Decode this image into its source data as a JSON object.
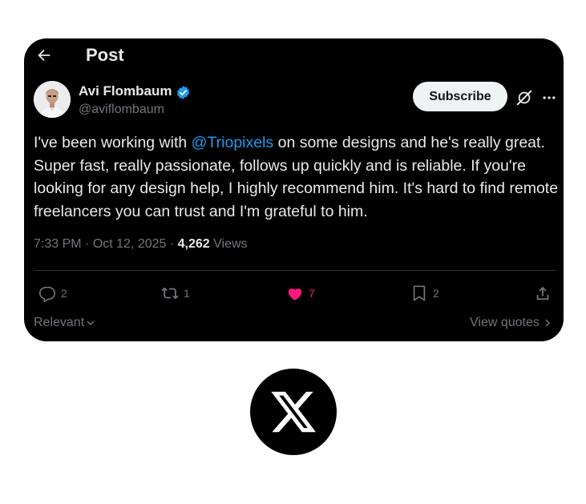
{
  "header": {
    "title": "Post"
  },
  "author": {
    "name": "Avi Flombaum",
    "handle": "@aviflombaum"
  },
  "buttons": {
    "subscribe": "Subscribe"
  },
  "post": {
    "text_before": "I've been working with ",
    "mention": "@Triopixels",
    "text_after": " on some designs and he's really great. Super fast, really passionate, follows up quickly and is reliable. If you're looking for any design help, I highly recommend him. It's hard to find remote freelancers you can trust and I'm grateful to him."
  },
  "meta": {
    "time": "7:33 PM",
    "sep1": " · ",
    "date": "Oct 12, 2025",
    "sep2": " · ",
    "views_count": "4,262",
    "views_label": " Views"
  },
  "actions": {
    "replies": "2",
    "reposts": "1",
    "likes": "7",
    "bookmarks": "2"
  },
  "footer": {
    "sort": "Relevant",
    "view_quotes": "View quotes"
  },
  "colors": {
    "accent": "#1d9bf0",
    "like": "#f91880",
    "verified": "#1d9bf0",
    "background": "#000000"
  },
  "icons": [
    "back-arrow-icon",
    "verified-badge-icon",
    "grok-icon",
    "more-icon",
    "reply-icon",
    "repost-icon",
    "heart-icon",
    "bookmark-icon",
    "share-icon",
    "chevron-down-icon",
    "chevron-right-icon",
    "x-logo-icon"
  ]
}
